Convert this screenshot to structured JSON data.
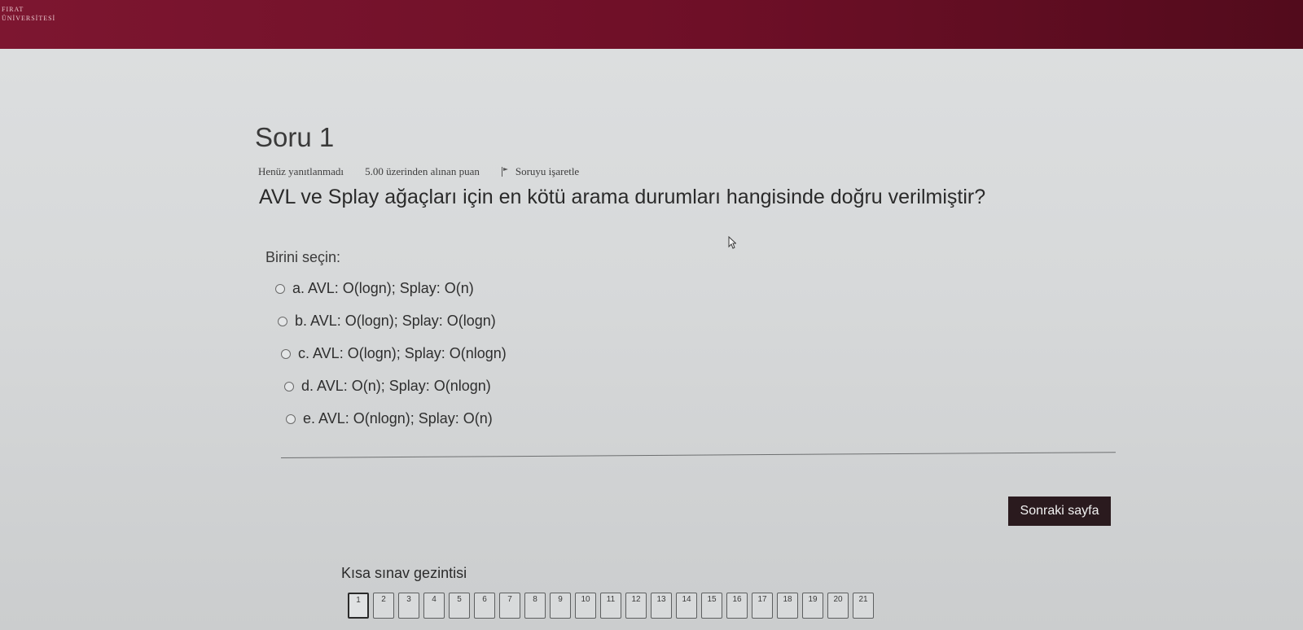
{
  "header": {
    "logo_line1": "FIRAT",
    "logo_line2": "ÜNİVERSİTESİ"
  },
  "question": {
    "title": "Soru 1",
    "status": "Henüz yanıtlanmadı",
    "points": "5.00 üzerinden alınan puan",
    "flag_label": "Soruyu işaretle",
    "text": "AVL ve Splay ağaçları için en kötü arama durumları hangisinde doğru verilmiştir?",
    "prompt": "Birini seçin:",
    "options": [
      {
        "label": "a. AVL: O(logn); Splay: O(n)"
      },
      {
        "label": "b. AVL: O(logn); Splay: O(logn)"
      },
      {
        "label": "c. AVL: O(logn); Splay: O(nlogn)"
      },
      {
        "label": "d. AVL: O(n); Splay: O(nlogn)"
      },
      {
        "label": "e. AVL: O(nlogn); Splay: O(n)"
      }
    ]
  },
  "actions": {
    "next_label": "Sonraki sayfa"
  },
  "navigation": {
    "title": "Kısa sınav gezintisi",
    "current": "1",
    "pages": [
      "1",
      "2",
      "3",
      "4",
      "5",
      "6",
      "7",
      "8",
      "9",
      "10",
      "11",
      "12",
      "13",
      "14",
      "15",
      "16",
      "17",
      "18",
      "19",
      "20",
      "21"
    ]
  },
  "colors": {
    "header_bg": "#7d1630",
    "button_bg": "#2a1a1e",
    "page_bg": "#d7d9da"
  }
}
